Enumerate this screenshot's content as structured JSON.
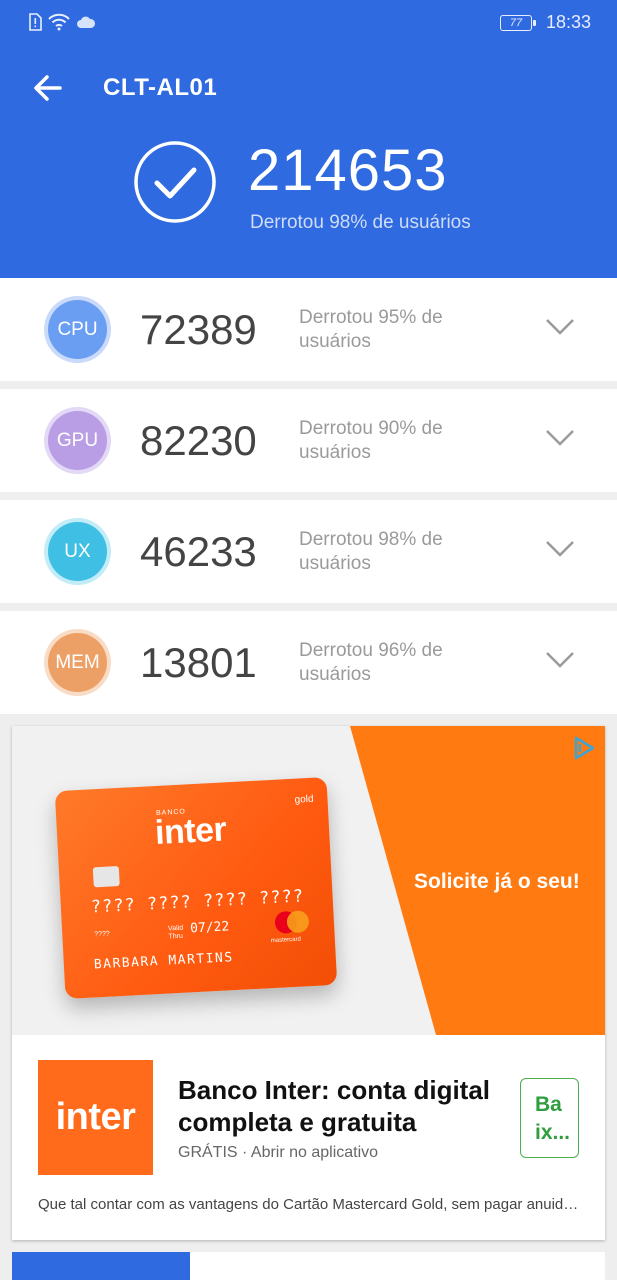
{
  "status_bar": {
    "time": "18:33",
    "battery": "77",
    "icons": [
      "alert-sim-icon",
      "wifi-icon",
      "cloud-icon"
    ]
  },
  "header": {
    "title": "CLT-AL01",
    "total_score": "214653",
    "subtitle": "Derrotou 98% de usuários",
    "background": "#2f6ae0"
  },
  "scores": [
    {
      "label": "CPU",
      "score": "72389",
      "desc": "Derrotou 95% de usuários",
      "color": "#6a9ef2",
      "ring": "#c9dafa"
    },
    {
      "label": "GPU",
      "score": "82230",
      "desc": "Derrotou 90% de usuários",
      "color": "#b99ee6",
      "ring": "#e3d8f5"
    },
    {
      "label": "UX",
      "score": "46233",
      "desc": "Derrotou 98% de usuários",
      "color": "#3fbfe3",
      "ring": "#c2ecf7"
    },
    {
      "label": "MEM",
      "score": "13801",
      "desc": "Derrotou 96% de usuários",
      "color": "#eda066",
      "ring": "#f9dcc6"
    }
  ],
  "ad": {
    "banner_slogan": "Solicite já o seu!",
    "card": {
      "bank_small": "BANCO",
      "brand": "inter",
      "tier": "gold",
      "number": "???? ???? ???? ????",
      "small_code": "????",
      "valid_label": "Valid\nThru",
      "expiry": "07/22",
      "holder": "BARBARA MARTINS",
      "network": "mastercard"
    },
    "logo_text": "inter",
    "title": "Banco Inter: conta digital completa e gratuita",
    "meta": "GRÁTIS · Abrir no aplicativo",
    "install_label": "Ba ix...",
    "description": "Que tal contar com as vantagens do Cartão Mastercard Gold, sem pagar anuidade?",
    "accent": "#ff6b1a"
  }
}
